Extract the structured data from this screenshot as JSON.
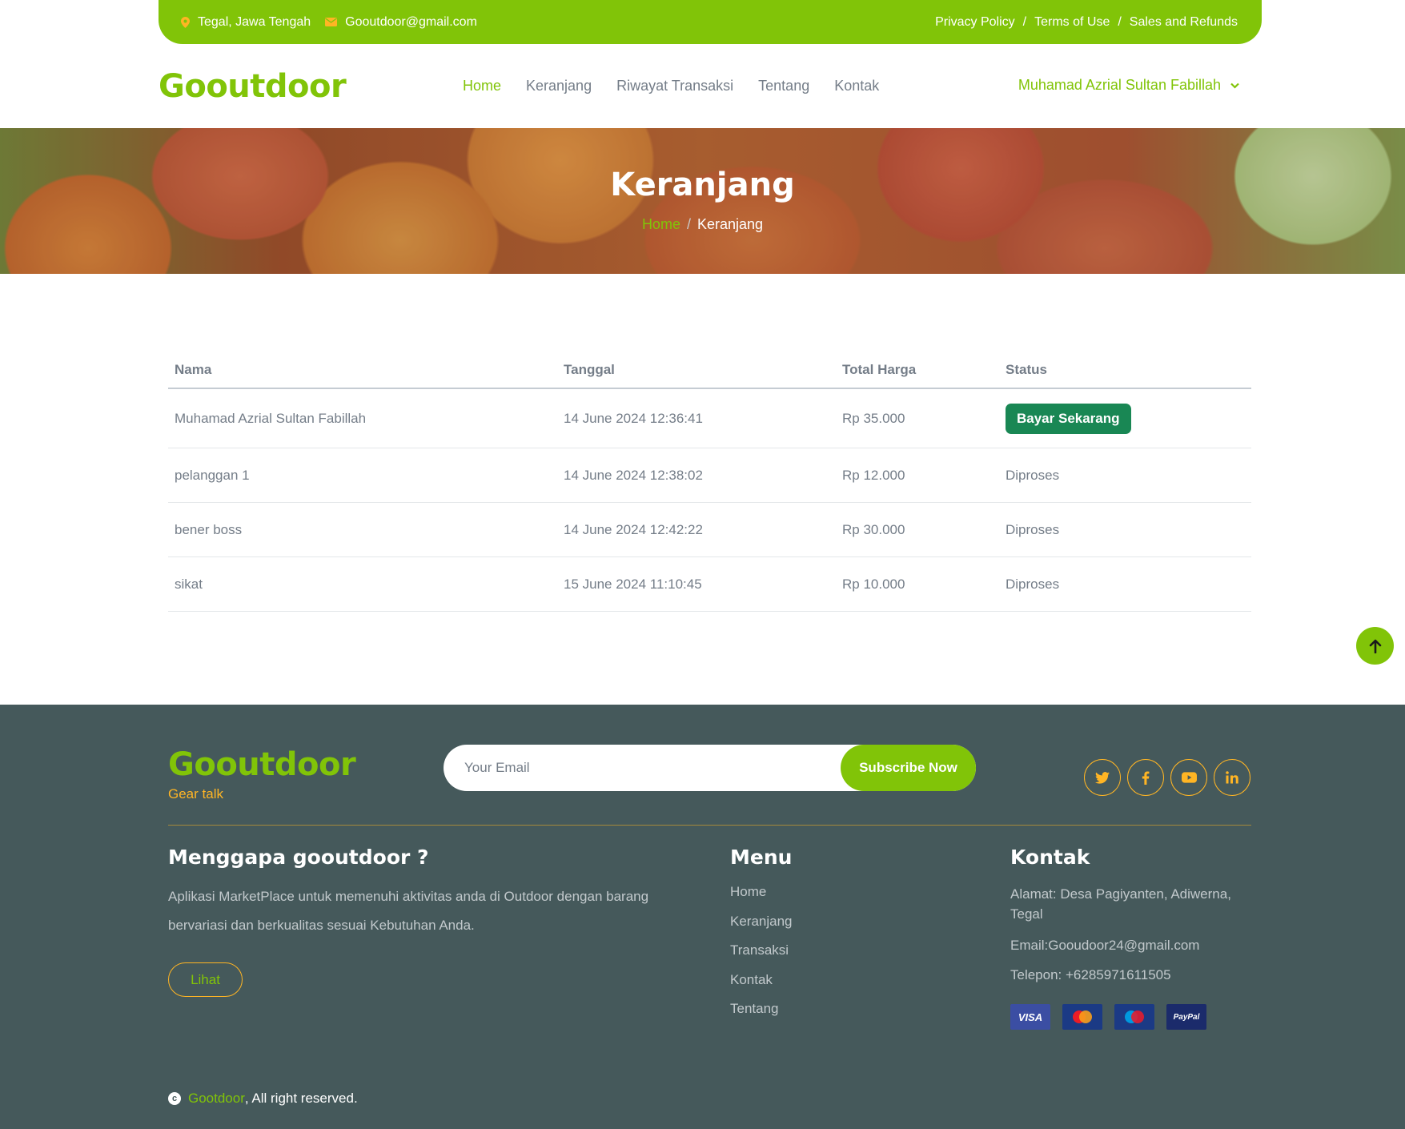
{
  "topbar": {
    "location": "Tegal, Jawa Tengah",
    "email": "Gooutdoor@gmail.com",
    "links": [
      "Privacy Policy",
      "Terms of Use",
      "Sales and Refunds"
    ],
    "separator": "/"
  },
  "navbar": {
    "brand": "Gooutdoor",
    "links": [
      "Home",
      "Keranjang",
      "Riwayat Transaksi",
      "Tentang",
      "Kontak"
    ],
    "active": "Home",
    "user": "Muhamad Azrial Sultan Fabillah"
  },
  "hero": {
    "title": "Keranjang",
    "breadcrumb_home": "Home",
    "breadcrumb_sep": "/",
    "breadcrumb_current": "Keranjang"
  },
  "table": {
    "headers": [
      "Nama",
      "Tanggal",
      "Total Harga",
      "Status"
    ],
    "rows": [
      {
        "nama": "Muhamad Azrial Sultan Fabillah",
        "tanggal": "14 June 2024 12:36:41",
        "total": "Rp 35.000",
        "status": "Bayar Sekarang"
      },
      {
        "nama": "pelanggan 1",
        "tanggal": "14 June 2024 12:38:02",
        "total": "Rp 12.000",
        "status": "Diproses"
      },
      {
        "nama": "bener boss",
        "tanggal": "14 June 2024 12:42:22",
        "total": "Rp 30.000",
        "status": "Diproses"
      },
      {
        "nama": "sikat",
        "tanggal": "15 June 2024 11:10:45",
        "total": "Rp 10.000",
        "status": "Diproses"
      }
    ]
  },
  "footer": {
    "brand": "Gooutdoor",
    "tagline": "Gear talk",
    "email_placeholder": "Your Email",
    "subscribe_label": "Subscribe Now",
    "socials": [
      "twitter-icon",
      "facebook-icon",
      "youtube-icon",
      "linkedin-icon"
    ],
    "about": {
      "title": "Menggapa gooutdoor ?",
      "text": "Aplikasi MarketPlace untuk memenuhi aktivitas anda di Outdoor dengan barang bervariasi dan berkualitas sesuai Kebutuhan Anda.",
      "button": "Lihat"
    },
    "menu": {
      "title": "Menu",
      "items": [
        "Home",
        "Keranjang",
        "Transaksi",
        "Kontak",
        "Tentang"
      ]
    },
    "contact": {
      "title": "Kontak",
      "address": "Alamat: Desa Pagiyanten, Adiwerna, Tegal",
      "email": "Email:Gooudoor24@gmail.com",
      "phone": "Telepon: +6285971611505"
    },
    "payment_cards": [
      "VISA",
      "MasterCard",
      "Maestro",
      "PayPal"
    ],
    "copyright_brand": "Gootdoor",
    "copyright_text": ", All right reserved."
  },
  "colors": {
    "primary": "#81c408",
    "secondary": "#ffb524",
    "footer_bg": "#45595b",
    "pay_button": "#198754"
  }
}
